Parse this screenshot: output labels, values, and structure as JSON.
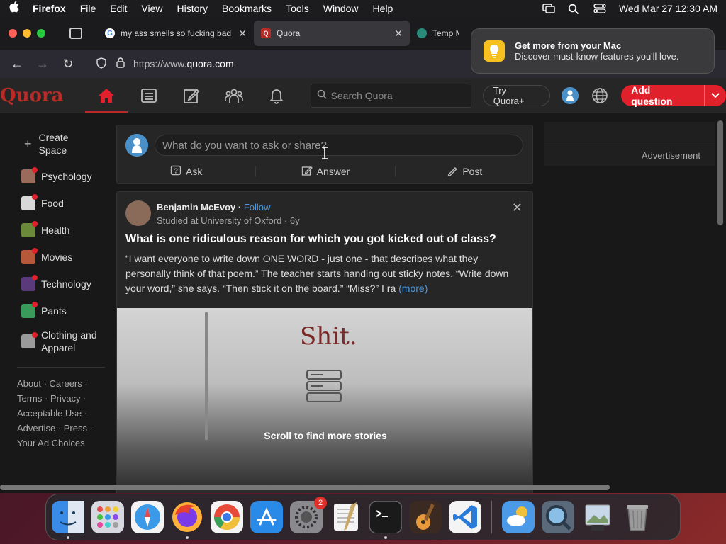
{
  "menubar": {
    "app": "Firefox",
    "items": [
      "File",
      "Edit",
      "View",
      "History",
      "Bookmarks",
      "Tools",
      "Window",
      "Help"
    ],
    "datetime": "Wed Mar 27  12:30 AM"
  },
  "browser": {
    "tabs": [
      {
        "title": "my ass smells so fucking bad - ",
        "favicon": "google-g",
        "active": false
      },
      {
        "title": "Quora",
        "favicon": "quora-q",
        "active": true
      },
      {
        "title": "Temp M",
        "favicon": "temp-mail",
        "active": false
      }
    ],
    "url_prefix": "https://www.",
    "url_host": "quora.com"
  },
  "notification": {
    "title": "Get more from your Mac",
    "body": "Discover must-know features you'll love."
  },
  "quora": {
    "logo": "Quora",
    "search_placeholder": "Search Quora",
    "try_plus": "Try Quora+",
    "add_question": "Add question",
    "sidebar": {
      "create_space": "Create Space",
      "spaces": [
        {
          "label": "Psychology",
          "color": "#9a6a5a"
        },
        {
          "label": "Food",
          "color": "#d8d8d8"
        },
        {
          "label": "Health",
          "color": "#6a8a3a"
        },
        {
          "label": "Movies",
          "color": "#b8583a"
        },
        {
          "label": "Technology",
          "color": "#5a3a7a"
        },
        {
          "label": "Pants",
          "color": "#3a9a5a"
        },
        {
          "label": "Clothing and Apparel",
          "color": "#9a9a9a"
        }
      ],
      "footer": "About · Careers · Terms · Privacy · Acceptable Use · Advertise · Press · Your Ad Choices"
    },
    "composer": {
      "placeholder": "What do you want to ask or share?",
      "ask": "Ask",
      "answer": "Answer",
      "post": "Post"
    },
    "post": {
      "author": "Benjamin McEvoy",
      "follow": "Follow",
      "credential": "Studied at University of Oxford · 6y",
      "question": "What is one ridiculous reason for which you got kicked out of class?",
      "excerpt": "“I want everyone to write down ONE WORD - just one - that describes what they personally think of that poem.” The teacher starts handing out sticky notes. “Write down your word,” she says. “Then stick it on the board.” “Miss?” I ra",
      "more": "(more)",
      "image_text": "Shit.",
      "scroll_msg": "Scroll to find more stories"
    },
    "ad_label": "Advertisement"
  },
  "dock": {
    "apps": [
      {
        "name": "finder",
        "color": "#3a8ae8",
        "running": true
      },
      {
        "name": "launchpad",
        "color": "#d8d8e0",
        "running": false
      },
      {
        "name": "safari",
        "color": "#3a9ae8",
        "running": false
      },
      {
        "name": "firefox",
        "color": "#e8622a",
        "running": true
      },
      {
        "name": "chrome",
        "color": "#e8e8e8",
        "running": false
      },
      {
        "name": "app-store",
        "color": "#2a8ae8",
        "running": false
      },
      {
        "name": "system-settings",
        "color": "#8a8a8e",
        "running": false,
        "badge": "2"
      },
      {
        "name": "textedit",
        "color": "#f0f0f0",
        "running": false
      },
      {
        "name": "terminal",
        "color": "#1a1a1a",
        "running": true
      },
      {
        "name": "garageband",
        "color": "#5a3a2a",
        "running": false
      },
      {
        "name": "vscode",
        "color": "#2a7ad8",
        "running": false
      }
    ],
    "recent": [
      {
        "name": "weather",
        "color": "#4a9ae8"
      },
      {
        "name": "quicktime",
        "color": "#5a6a7a"
      },
      {
        "name": "preview",
        "color": "#c8d8e8"
      }
    ],
    "trash": {
      "name": "trash",
      "color": "#8a8a8a"
    }
  }
}
